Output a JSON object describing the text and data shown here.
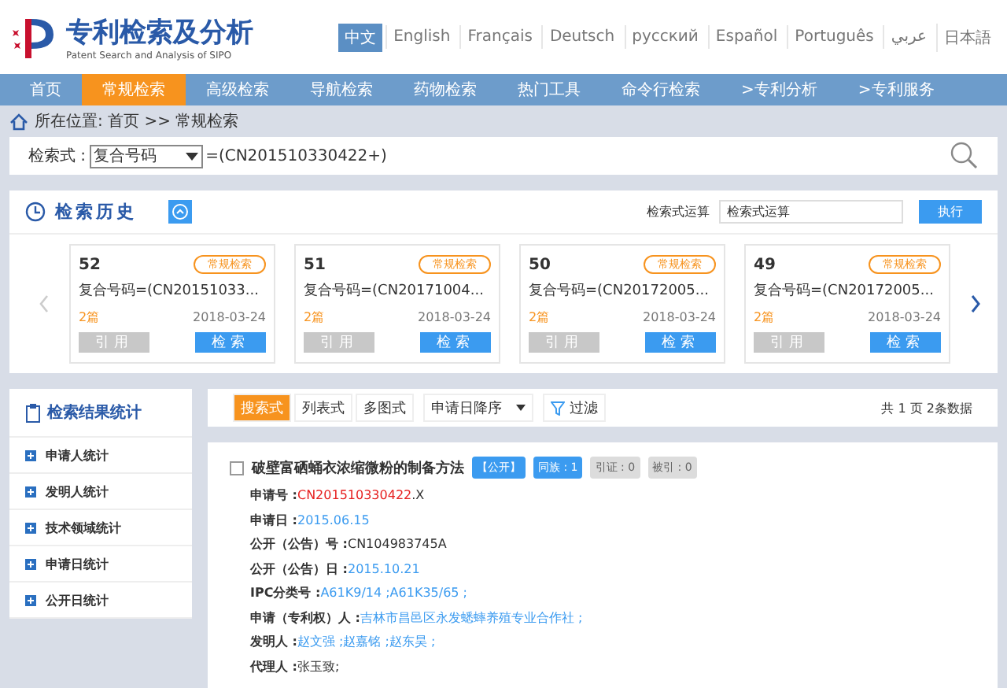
{
  "header": {
    "title": "专利检索及分析",
    "subtitle": "Patent Search and Analysis of SIPO",
    "languages": [
      {
        "label": "中文",
        "selected": true
      },
      {
        "label": "English",
        "selected": false
      },
      {
        "label": "Français",
        "selected": false
      },
      {
        "label": "Deutsch",
        "selected": false
      },
      {
        "label": "русский",
        "selected": false
      },
      {
        "label": "Español",
        "selected": false
      },
      {
        "label": "Português",
        "selected": false
      },
      {
        "label": "عربي",
        "selected": false
      },
      {
        "label": "日本語",
        "selected": false
      }
    ]
  },
  "nav": [
    {
      "label": "首页",
      "selected": false
    },
    {
      "label": "常规检索",
      "selected": true
    },
    {
      "label": "高级检索",
      "selected": false
    },
    {
      "label": "导航检索",
      "selected": false
    },
    {
      "label": "药物检索",
      "selected": false
    },
    {
      "label": "热门工具",
      "selected": false
    },
    {
      "label": "命令行检索",
      "selected": false
    },
    {
      "label": ">专利分析",
      "selected": false
    },
    {
      "label": ">专利服务",
      "selected": false
    }
  ],
  "breadcrumb": "所在位置: 首页 >> 常规检索",
  "search": {
    "label": "检索式 :",
    "field": "复合号码",
    "query": "=(CN201510330422+)"
  },
  "history": {
    "title": "检索历史",
    "operation_label": "检索式运算",
    "operation_placeholder": "检索式运算",
    "run_button": "执行",
    "cards": [
      {
        "number": "52",
        "tag": "常规检索",
        "query": "复合号码=(CN20151033...",
        "count": "2篇",
        "date": "2018-03-24",
        "cite": "引用",
        "search": "检索"
      },
      {
        "number": "51",
        "tag": "常规检索",
        "query": "复合号码=(CN20171004...",
        "count": "2篇",
        "date": "2018-03-24",
        "cite": "引用",
        "search": "检索"
      },
      {
        "number": "50",
        "tag": "常规检索",
        "query": "复合号码=(CN20172005...",
        "count": "2篇",
        "date": "2018-03-24",
        "cite": "引用",
        "search": "检索"
      },
      {
        "number": "49",
        "tag": "常规检索",
        "query": "复合号码=(CN20172005...",
        "count": "2篇",
        "date": "2018-03-24",
        "cite": "引用",
        "search": "检索"
      }
    ]
  },
  "stats": {
    "title": "检索结果统计",
    "items": [
      "申请人统计",
      "发明人统计",
      "技术领域统计",
      "申请日统计",
      "公开日统计"
    ]
  },
  "toolbar": {
    "views": [
      {
        "label": "搜索式",
        "selected": true
      },
      {
        "label": "列表式",
        "selected": false
      },
      {
        "label": "多图式",
        "selected": false
      }
    ],
    "sort": "申请日降序",
    "filter": "过滤",
    "summary": "共 1 页 2条数据"
  },
  "result": {
    "checked": false,
    "title": "破壁富硒蛹衣浓缩微粉的制备方法",
    "badges": [
      {
        "label": "【公开】",
        "active": true
      },
      {
        "label": "同族 : 1",
        "active": true
      },
      {
        "label": "引证 : 0",
        "active": false
      },
      {
        "label": "被引 : 0",
        "active": false
      }
    ],
    "fields": [
      {
        "label": "申请号 :",
        "value": "CN201510330422",
        "suffix": ".X",
        "kind": "highlight"
      },
      {
        "label": "申请日 :",
        "value": "2015.06.15",
        "kind": "link"
      },
      {
        "label": "公开（公告）号 :",
        "value": "CN104983745A",
        "kind": "plain"
      },
      {
        "label": "公开（公告）日 :",
        "value": "2015.10.21",
        "kind": "link"
      },
      {
        "label": "IPC分类号 :",
        "value": "A61K9/14 ;A61K35/65 ;",
        "kind": "link"
      },
      {
        "label": "申请（专利权）人 :",
        "value": "吉林市昌邑区永发蟋蟀养殖专业合作社 ;",
        "kind": "link"
      },
      {
        "label": "发明人 :",
        "value": "赵文强 ;赵嘉铭 ;赵东昊 ;",
        "kind": "link"
      },
      {
        "label": "代理人 :",
        "value": "张玉致;",
        "kind": "plain"
      }
    ]
  }
}
